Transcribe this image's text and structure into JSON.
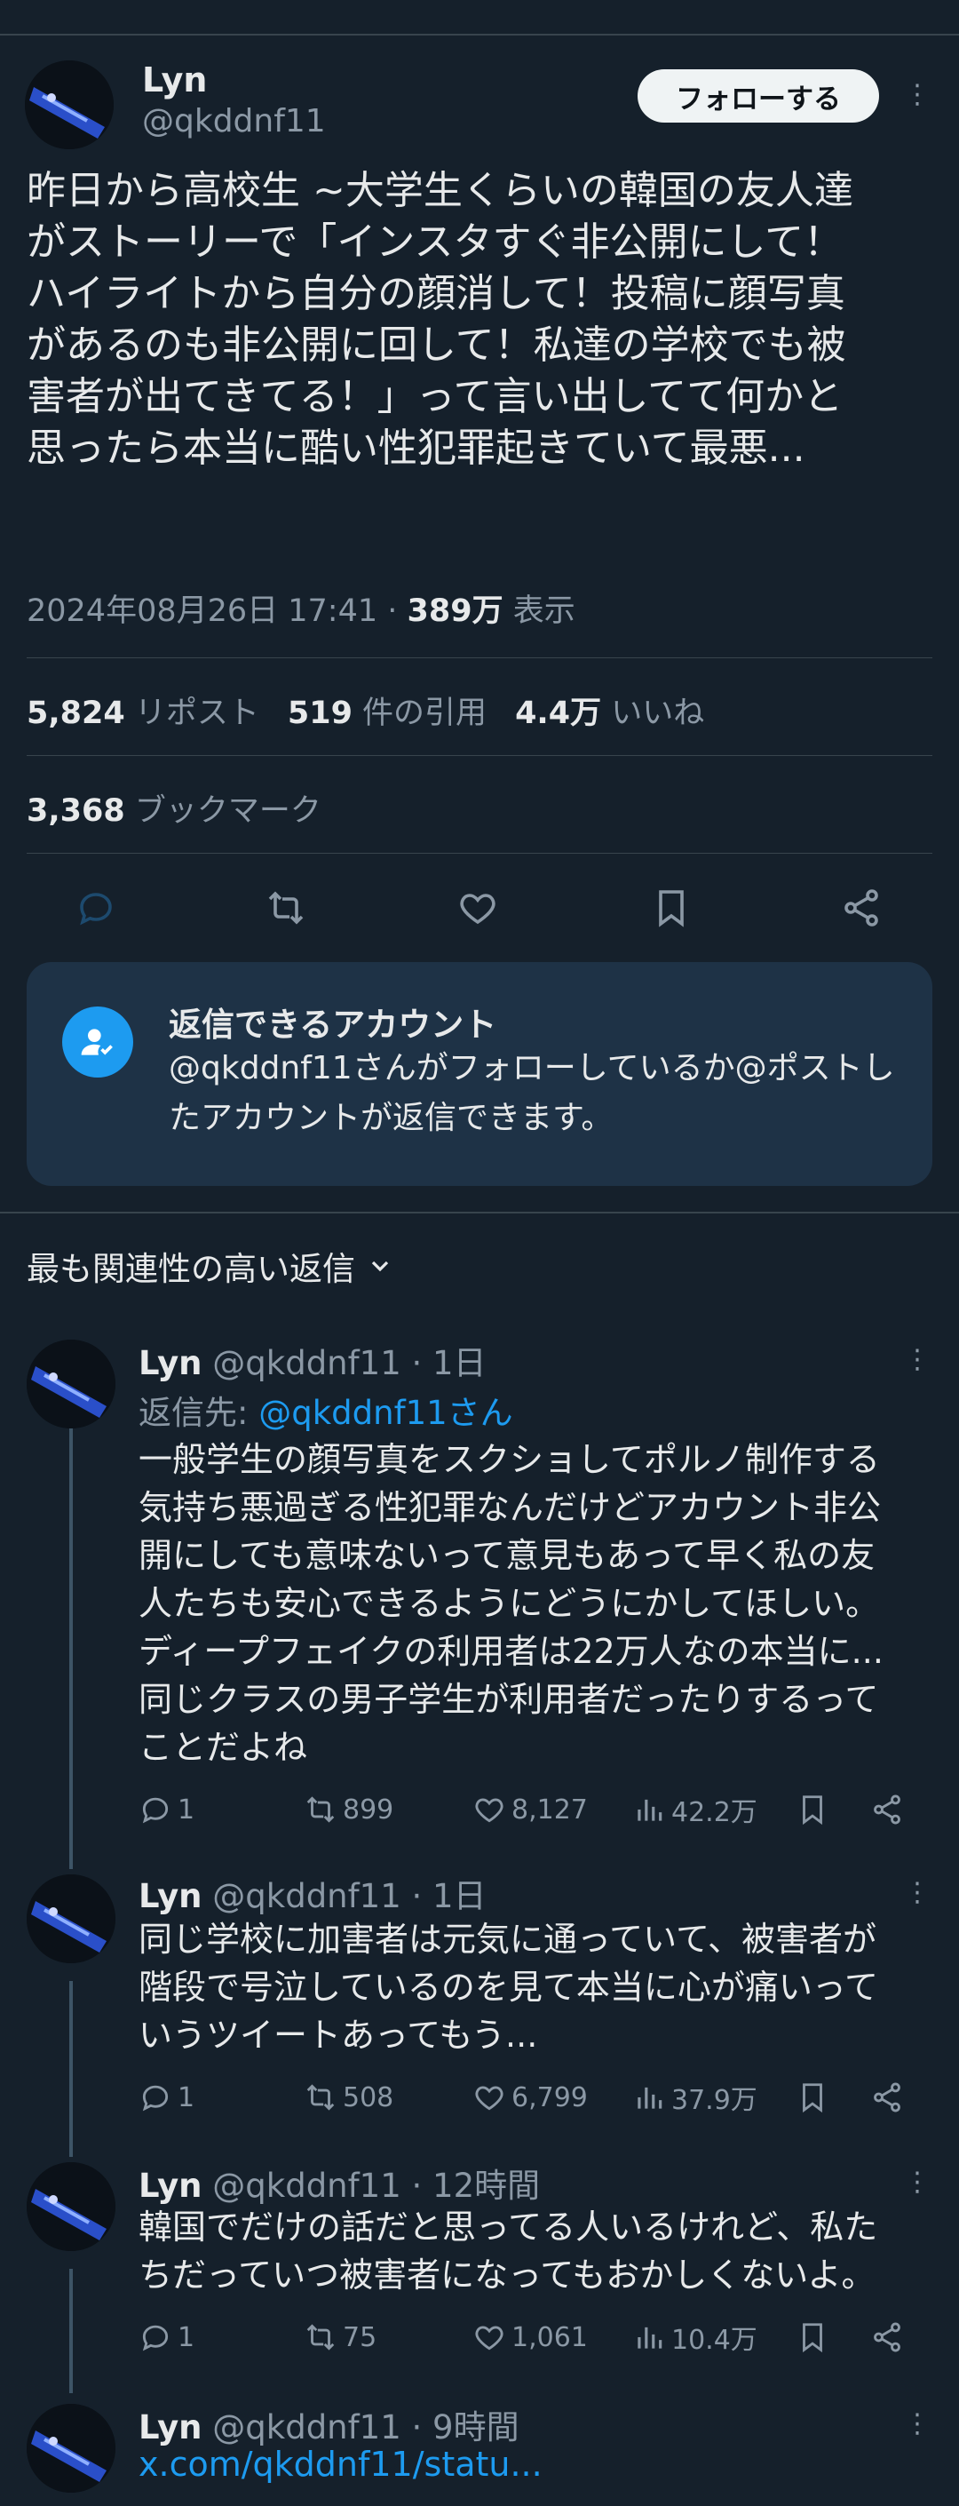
{
  "post": {
    "author_name": "Lyn",
    "author_handle": "@qkddnf11",
    "follow_label": "フォローする",
    "more_glyph": "⋮",
    "text": "昨日から高校生 ~大学生くらいの韓国の友人達\nがストーリーで「インスタすぐ非公開にして！\nハイライトから自分の顔消して！投稿に顔写真\nがあるのも非公開に回して！私達の学校でも被\n害者が出てきてる！」って言い出してて何かと\n思ったら本当に酷い性犯罪起きていて最悪...",
    "timestamp": "2024年08月26日 17:41",
    "separator": " · ",
    "views_count": "389万",
    "views_label": " 表示",
    "reposts_count": "5,824",
    "reposts_label": " リポスト",
    "quotes_count": "519",
    "quotes_label": " 件の引用",
    "likes_count": "4.4万",
    "likes_label": " いいね",
    "bookmarks_count": "3,368",
    "bookmarks_label": " ブックマーク"
  },
  "reply_restriction": {
    "title": "返信できるアカウント",
    "description": "@qkddnf11さんがフォローしているか@ポストしたアカウントが返信できます。"
  },
  "sort": {
    "label": "最も関連性の高い返信"
  },
  "replies": [
    {
      "name": "Lyn",
      "handle": "@qkddnf11",
      "time": " · 1日",
      "reply_to_prefix": "返信先: ",
      "reply_to_handle": "@qkddnf11さん",
      "text": "一般学生の顔写真をスクショしてポルノ制作する\n気持ち悪過ぎる性犯罪なんだけどアカウント非公\n開にしても意味ないって意見もあって早く私の友\n人たちも安心できるようにどうにかしてほしい。\nディープフェイクの利用者は22万人なの本当に...\n同じクラスの男子学生が利用者だったりするって\nことだよね",
      "replies": "1",
      "retweets": "899",
      "likes": "8,127",
      "views": "42.2万"
    },
    {
      "name": "Lyn",
      "handle": "@qkddnf11",
      "time": " · 1日",
      "text": "同じ学校に加害者は元気に通っていて、被害者が\n階段で号泣しているのを見て本当に心が痛いって\nいうツイートあってもう...",
      "replies": "1",
      "retweets": "508",
      "likes": "6,799",
      "views": "37.9万"
    },
    {
      "name": "Lyn",
      "handle": "@qkddnf11",
      "time": " · 12時間",
      "text": "韓国でだけの話だと思ってる人いるけれど、私た\nちだっていつ被害者になってもおかしくないよ。",
      "replies": "1",
      "retweets": "75",
      "likes": "1,061",
      "views": "10.4万"
    },
    {
      "name": "Lyn",
      "handle": "@qkddnf11",
      "time": " · 9時間",
      "link": "x.com/qkddnf11/statu..."
    }
  ],
  "colors": {
    "background": "#15202b",
    "accent": "#1d9bf0",
    "muted": "#8b98a5",
    "text": "#e7e9ea",
    "reply_box": "#1e3246"
  },
  "icons": [
    "reply-icon",
    "retweet-icon",
    "like-icon",
    "bookmark-icon",
    "share-icon",
    "views-icon",
    "more-icon",
    "user-check-icon",
    "chevron-down-icon"
  ]
}
